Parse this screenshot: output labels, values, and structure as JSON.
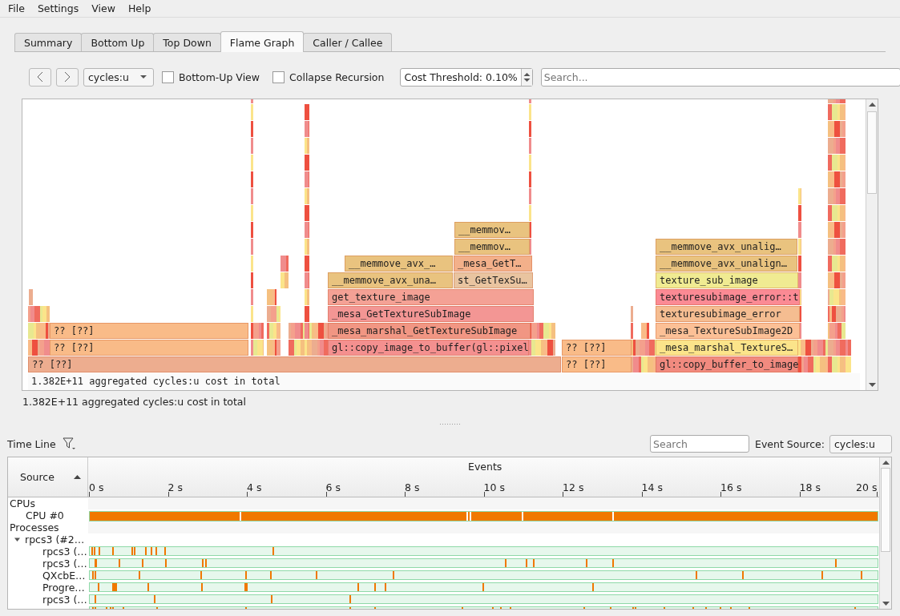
{
  "menu": [
    {
      "label": "File"
    },
    {
      "label": "Settings"
    },
    {
      "label": "View"
    },
    {
      "label": "Help"
    }
  ],
  "tabs": [
    {
      "label": "Summary",
      "selected": false
    },
    {
      "label": "Bottom Up",
      "selected": false
    },
    {
      "label": "Top Down",
      "selected": false
    },
    {
      "label": "Flame Graph",
      "selected": true
    },
    {
      "label": "Caller / Callee",
      "selected": false
    }
  ],
  "toolbar": {
    "event": "cycles:u",
    "options": [
      {
        "label": "Bottom-Up View",
        "checked": false
      },
      {
        "label": "Collapse Recursion",
        "checked": false
      }
    ],
    "threshold": "Cost Threshold: 0.10%",
    "search": {
      "placeholder": "Search..."
    }
  },
  "flame_graph": {
    "frames": [
      {
        "label": "__memmov…",
        "color": "#e9c37f"
      },
      {
        "label": "__memmov…",
        "color": "#e9c37f"
      },
      {
        "label": "__memmove_avx_unalig…",
        "color": "#e9c37f"
      },
      {
        "label": "__memmove_avx_…",
        "color": "#e9c37f"
      },
      {
        "label": "_mesa_GetT…",
        "color": "#f3b08a"
      },
      {
        "label": "__memmove_avx_unalign…",
        "color": "#e9c37f"
      },
      {
        "label": "__memmove_avx_una…",
        "color": "#e9c37f"
      },
      {
        "label": "st_GetTexSu…",
        "color": "#e9c4a0"
      },
      {
        "label": "texture_sub_image",
        "color": "#f0eb92"
      },
      {
        "label": "get_texture_image",
        "color": "#f4a195"
      },
      {
        "label": "texturesubimage_error::t",
        "color": "#fb8a94"
      },
      {
        "label": "_mesa_GetTextureSubImage",
        "color": "#f39694"
      },
      {
        "label": "texturesubimage_error",
        "color": "#f5bd91"
      },
      {
        "label": "?? [??]",
        "color": "#f9bb88"
      },
      {
        "label": "_mesa_marshal_GetTextureSubImage",
        "color": "#f19683"
      },
      {
        "label": "_mesa_TextureSubImage2D",
        "color": "#fcc096"
      },
      {
        "label": "?? [??]",
        "color": "#f9bb88"
      },
      {
        "label": "gl::copy_image_to_buffer(gl::pixel",
        "color": "#f4908f"
      },
      {
        "label": "?? [??]",
        "color": "#f9bb88"
      },
      {
        "label": "_mesa_marshal_TextureS…",
        "color": "#fbe48a"
      },
      {
        "label": "?? [??]",
        "color": "#edad8f"
      },
      {
        "label": "?? [??]",
        "color": "#f9bb88"
      },
      {
        "label": "gl::copy_buffer_to_image",
        "color": "#f18a7f"
      }
    ],
    "total": "1.382E+11 aggregated cycles:u cost in total"
  },
  "summary": "1.382E+11 aggregated cycles:u cost in total",
  "timeline": {
    "title": "Time Line",
    "search": {
      "placeholder": "Search"
    },
    "event_source_label": "Event Source:",
    "event_source": "cycles:u",
    "columns": [
      "Source",
      "Events"
    ],
    "axis_ticks": [
      "0 s",
      "2 s",
      "4 s",
      "6 s",
      "8 s",
      "10 s",
      "12 s",
      "14 s",
      "16 s",
      "18 s",
      "20 s"
    ],
    "rows": [
      {
        "label": "CPUs",
        "kind": "group"
      },
      {
        "label": "CPU #0",
        "kind": "cpu"
      },
      {
        "label": "Processes",
        "kind": "group"
      },
      {
        "label": "rpcs3 (#2…",
        "kind": "process",
        "expanded": true,
        "children": [
          {
            "label": "rpcs3 (…",
            "kind": "thread"
          },
          {
            "label": "rpcs3 (…",
            "kind": "thread"
          },
          {
            "label": "QXcbE…",
            "kind": "thread"
          },
          {
            "label": "Progre…",
            "kind": "thread"
          },
          {
            "label": "rpcs3 (…",
            "kind": "thread"
          },
          {
            "kind": "thread"
          }
        ]
      }
    ]
  }
}
